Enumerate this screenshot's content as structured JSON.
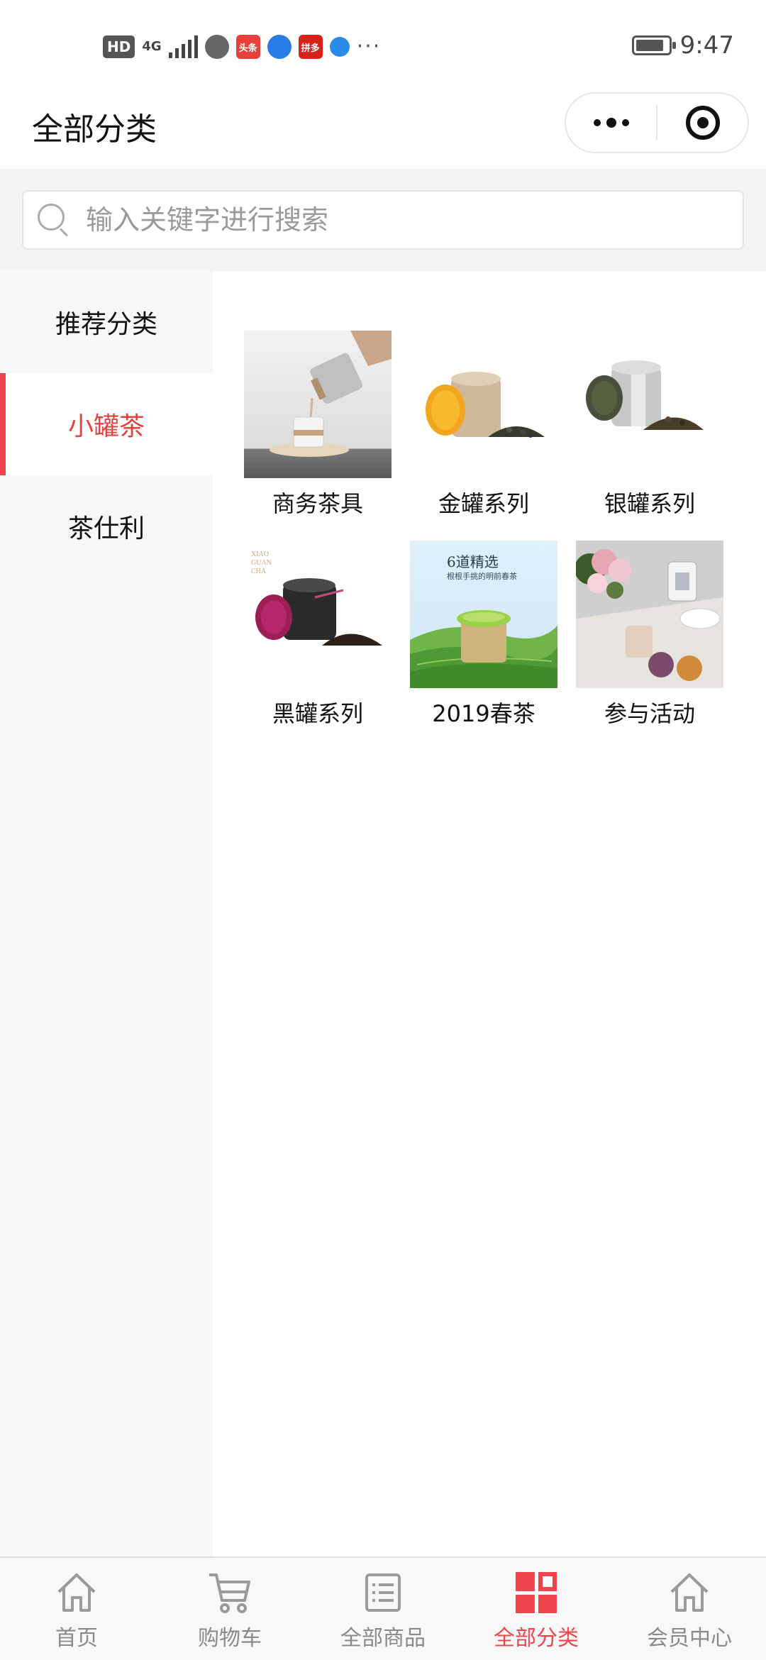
{
  "status_bar": {
    "hd": "HD",
    "network": "4G",
    "time": "9:47",
    "apps": [
      {
        "name": "browser-icon",
        "label": "",
        "color": "#666666"
      },
      {
        "name": "toutiao-icon",
        "label": "头条",
        "color": "#e8413a"
      },
      {
        "name": "qq-browser-icon",
        "label": "",
        "color": "#2a7be6"
      },
      {
        "name": "pinduoduo-icon",
        "label": "拼多",
        "color": "#d6221b"
      },
      {
        "name": "share-icon",
        "label": "",
        "color": "#2a8be6"
      }
    ],
    "more": "···"
  },
  "nav": {
    "title": "全部分类"
  },
  "search": {
    "placeholder": "输入关键字进行搜索"
  },
  "sidebar": {
    "items": [
      {
        "label": "推荐分类",
        "active": false
      },
      {
        "label": "小罐茶",
        "active": true
      },
      {
        "label": "茶仕利",
        "active": false
      }
    ]
  },
  "categories": [
    {
      "label": "商务茶具",
      "thumb": "business-teaware-photo"
    },
    {
      "label": "金罐系列",
      "thumb": "gold-can-photo"
    },
    {
      "label": "银罐系列",
      "thumb": "silver-can-photo"
    },
    {
      "label": "黑罐系列",
      "thumb": "black-can-photo"
    },
    {
      "label": "2019春茶",
      "thumb": "spring-tea-2019-photo",
      "overlay_title": "6道精选",
      "overlay_sub": "根根手挑的明前春茶"
    },
    {
      "label": "参与活动",
      "thumb": "event-photo"
    }
  ],
  "tabbar": {
    "accent": "#f0454a",
    "items": [
      {
        "label": "首页",
        "icon": "home-icon",
        "active": false
      },
      {
        "label": "购物车",
        "icon": "cart-icon",
        "active": false
      },
      {
        "label": "全部商品",
        "icon": "list-icon",
        "active": false
      },
      {
        "label": "全部分类",
        "icon": "grid-icon",
        "active": true
      },
      {
        "label": "会员中心",
        "icon": "member-home-icon",
        "active": false
      }
    ]
  }
}
